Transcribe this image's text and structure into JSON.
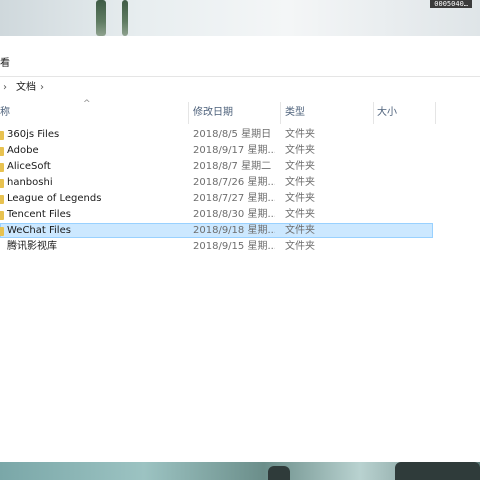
{
  "desktop": {
    "note_text": "0005040…",
    "accent": "#cce8ff"
  },
  "ribbon": {
    "tab_label": "看"
  },
  "address": {
    "crumb": "文档"
  },
  "columns": {
    "name": "称",
    "date": "修改日期",
    "type": "类型",
    "size": "大小"
  },
  "files": [
    {
      "name": "360js Files",
      "date": "2018/8/5 星期日 ...",
      "type": "文件夹",
      "folder_icon": true
    },
    {
      "name": "Adobe",
      "date": "2018/9/17 星期...",
      "type": "文件夹",
      "folder_icon": true
    },
    {
      "name": "AliceSoft",
      "date": "2018/8/7 星期二 ...",
      "type": "文件夹",
      "folder_icon": true
    },
    {
      "name": "hanboshi",
      "date": "2018/7/26 星期...",
      "type": "文件夹",
      "folder_icon": true
    },
    {
      "name": "League of Legends",
      "date": "2018/7/27 星期...",
      "type": "文件夹",
      "folder_icon": true
    },
    {
      "name": "Tencent Files",
      "date": "2018/8/30 星期...",
      "type": "文件夹",
      "folder_icon": true
    },
    {
      "name": "WeChat Files",
      "date": "2018/9/18 星期...",
      "type": "文件夹",
      "folder_icon": true,
      "selected": true
    },
    {
      "name": "腾讯影视库",
      "date": "2018/9/15 星期...",
      "type": "文件夹",
      "folder_icon": false
    }
  ]
}
